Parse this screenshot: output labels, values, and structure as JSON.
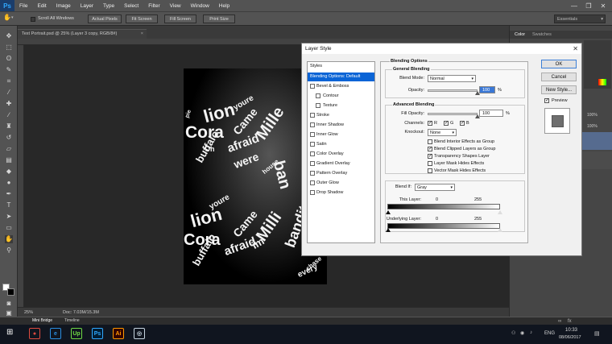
{
  "menubar": {
    "logo": "Ps",
    "items": [
      "File",
      "Edit",
      "Image",
      "Layer",
      "Type",
      "Select",
      "Filter",
      "View",
      "Window",
      "Help"
    ],
    "window_controls": [
      "—",
      "❐",
      "✕"
    ]
  },
  "optbar": {
    "scroll_all_windows": "Scroll All Windows",
    "actual_pixels": "Actual Pixels",
    "fit_screen": "Fit Screen",
    "fill_screen": "Fill Screen",
    "print_size": "Print Size",
    "workspace": "Essentials"
  },
  "document": {
    "tab_title": "Text Portrait.psd @ 25% (Layer 3 copy, RGB/8#)",
    "tab_close": "×",
    "words": [
      "lion",
      "Cora",
      "Came",
      "Mille",
      "afraid",
      "buffalo",
      "ban",
      "house",
      "youre",
      "Oh",
      "were",
      "pie",
      "lion",
      "Came",
      "Milli",
      "Cora",
      "afraid",
      "bandit",
      "every",
      "chase",
      "im",
      "youre",
      "buffalo"
    ]
  },
  "statusbar": {
    "zoom": "25%",
    "doc_info": "Doc: 7.03M/15.3M",
    "tabs": [
      "Mini Bridge",
      "Timeline"
    ]
  },
  "rpanel": {
    "tabs": [
      "Color",
      "Swatches"
    ],
    "values": [
      "100%",
      "100%"
    ]
  },
  "dialog": {
    "title": "Layer Style",
    "close": "✕",
    "styles_header": "Styles",
    "styles": [
      {
        "label": "Blending Options: Default",
        "selected": true,
        "checkbox": false,
        "sub": false
      },
      {
        "label": "Bevel & Emboss",
        "checkbox": true,
        "sub": false
      },
      {
        "label": "Contour",
        "checkbox": true,
        "sub": true
      },
      {
        "label": "Texture",
        "checkbox": true,
        "sub": true
      },
      {
        "label": "Stroke",
        "checkbox": true,
        "sub": false
      },
      {
        "label": "Inner Shadow",
        "checkbox": true,
        "sub": false
      },
      {
        "label": "Inner Glow",
        "checkbox": true,
        "sub": false
      },
      {
        "label": "Satin",
        "checkbox": true,
        "sub": false
      },
      {
        "label": "Color Overlay",
        "checkbox": true,
        "sub": false
      },
      {
        "label": "Gradient Overlay",
        "checkbox": true,
        "sub": false
      },
      {
        "label": "Pattern Overlay",
        "checkbox": true,
        "sub": false
      },
      {
        "label": "Outer Glow",
        "checkbox": true,
        "sub": false
      },
      {
        "label": "Drop Shadow",
        "checkbox": true,
        "sub": false
      }
    ],
    "blending_options_title": "Blending Options",
    "general_blending": "General Blending",
    "blend_mode_label": "Blend Mode:",
    "blend_mode_value": "Normal",
    "opacity_label": "Opacity:",
    "opacity_value": "100",
    "opacity_level": 1.0,
    "percent": "%",
    "advanced_blending": "Advanced Blending",
    "fill_opacity_label": "Fill Opacity:",
    "fill_opacity_value": "100",
    "fill_opacity_level": 1.0,
    "channels_label": "Channels:",
    "channels": [
      {
        "label": "R",
        "checked": true
      },
      {
        "label": "G",
        "checked": true
      },
      {
        "label": "B",
        "checked": true
      }
    ],
    "knockout_label": "Knockout:",
    "knockout_value": "None",
    "options": [
      {
        "label": "Blend Interior Effects as Group",
        "checked": false
      },
      {
        "label": "Blend Clipped Layers as Group",
        "checked": true
      },
      {
        "label": "Transparency Shapes Layer",
        "checked": true
      },
      {
        "label": "Layer Mask Hides Effects",
        "checked": false
      },
      {
        "label": "Vector Mask Hides Effects",
        "checked": false
      }
    ],
    "blend_if_label": "Blend If:",
    "blend_if_value": "Gray",
    "this_layer_label": "This Layer:",
    "this_layer_low": "0",
    "this_layer_high": "255",
    "underlying_layer_label": "Underlying Layer:",
    "underlying_low": "0",
    "underlying_high": "255",
    "buttons": {
      "ok": "OK",
      "cancel": "Cancel",
      "new_style": "New Style...",
      "preview": "Preview"
    },
    "preview_checked": true
  },
  "taskbar": {
    "apps": [
      "Chrome",
      "IE",
      "Upwork",
      "Ps",
      "Ai",
      "Steam"
    ],
    "app_glyphs": [
      "●",
      "e",
      "Up",
      "Ps",
      "Ai",
      "◎"
    ],
    "app_colors": [
      "#de4b3f",
      "#2a8ee0",
      "#6fda44",
      "#31a8ff",
      "#ff9a00",
      "#c7d5e0"
    ],
    "tray_language": "ENG",
    "time": "10:33",
    "date": "08/06/2017"
  }
}
